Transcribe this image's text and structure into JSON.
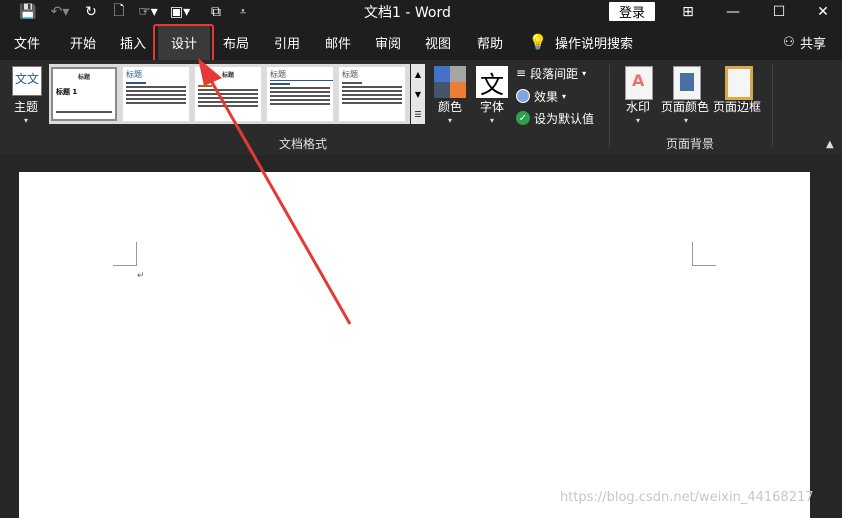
{
  "window": {
    "title": "文档1  -  Word",
    "login_label": "登录",
    "minimize": "—",
    "maximize": "☐",
    "close": "✕",
    "restore_ribbon": "⊞"
  },
  "tabs": [
    {
      "label": "文件"
    },
    {
      "label": "开始"
    },
    {
      "label": "插入"
    },
    {
      "label": "设计"
    },
    {
      "label": "布局"
    },
    {
      "label": "引用"
    },
    {
      "label": "邮件"
    },
    {
      "label": "审阅"
    },
    {
      "label": "视图"
    },
    {
      "label": "帮助"
    }
  ],
  "tell_me": "操作说明搜索",
  "share": "共享",
  "ribbon": {
    "theme_label": "主题",
    "theme_icon_text": "文文",
    "gallery": [
      {
        "heading": "标题",
        "subtitle": "标题 1",
        "selected": true
      },
      {
        "heading": "",
        "subtitle": "标题",
        "selected": false
      },
      {
        "heading": "标题",
        "subtitle": "",
        "selected": false
      },
      {
        "heading": "",
        "subtitle": "标题",
        "selected": false
      },
      {
        "heading": "",
        "subtitle": "标题",
        "selected": false
      }
    ],
    "colors_label": "颜色",
    "fonts_label": "字体",
    "fonts_icon_text": "文",
    "paragraph_spacing_label": "段落间距",
    "effects_label": "效果",
    "set_default_label": "设为默认值",
    "document_formatting_label": "文档格式",
    "watermark_label": "水印",
    "page_color_label": "页面颜色",
    "page_borders_label": "页面边框",
    "page_background_label": "页面背景"
  },
  "document": {
    "paragraph_mark": "↵"
  },
  "watermark_text": "https://blog.csdn.net/weixin_44168217",
  "colors": {
    "accent_red": "#e53935",
    "swatch_blue": "#4472c4",
    "swatch_orange": "#ed7d31",
    "swatch_gray": "#a5a5a5",
    "swatch_dark": "#44546a"
  }
}
